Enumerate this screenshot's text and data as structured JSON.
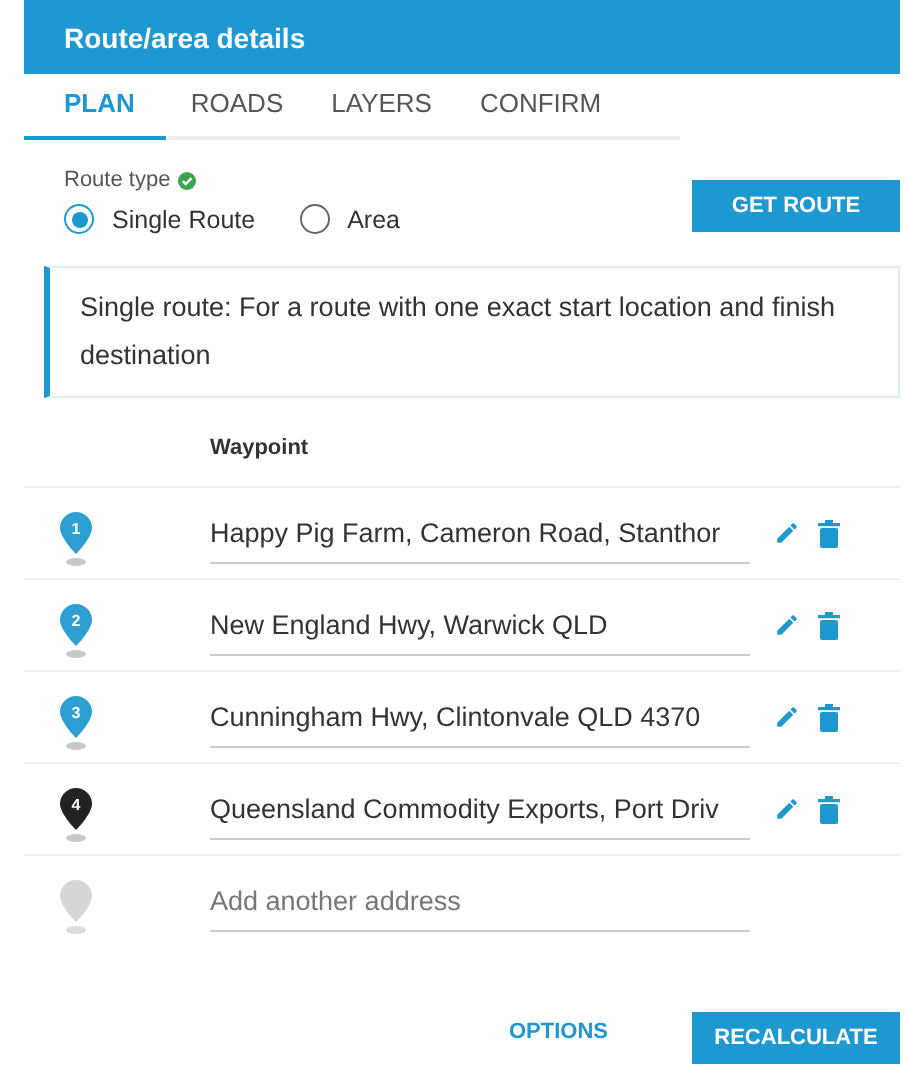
{
  "header": {
    "title": "Route/area details"
  },
  "tabs": [
    {
      "label": "PLAN",
      "selected": true
    },
    {
      "label": "ROADS",
      "selected": false
    },
    {
      "label": "LAYERS",
      "selected": false
    },
    {
      "label": "CONFIRM",
      "selected": false
    }
  ],
  "route_type": {
    "label": "Route type",
    "valid": true,
    "options": [
      {
        "label": "Single Route",
        "selected": true
      },
      {
        "label": "Area",
        "selected": false
      }
    ]
  },
  "get_route_button": "GET ROUTE",
  "info": "Single route: For a route with one exact start location and finish destination",
  "waypoints": {
    "column": "Waypoint",
    "rows": [
      {
        "number": "1",
        "color": "#2d9fd3",
        "address": "Happy Pig Farm, Cameron Road, Stanthor"
      },
      {
        "number": "2",
        "color": "#2d9fd3",
        "address": "New England Hwy, Warwick QLD"
      },
      {
        "number": "3",
        "color": "#2d9fd3",
        "address": "Cunningham Hwy, Clintonvale QLD 4370"
      },
      {
        "number": "4",
        "color": "#222222",
        "address": "Queensland Commodity Exports, Port Driv"
      }
    ],
    "add": {
      "placeholder": "Add another address"
    }
  },
  "footer": {
    "options": "OPTIONS",
    "recalculate": "RECALCULATE"
  }
}
